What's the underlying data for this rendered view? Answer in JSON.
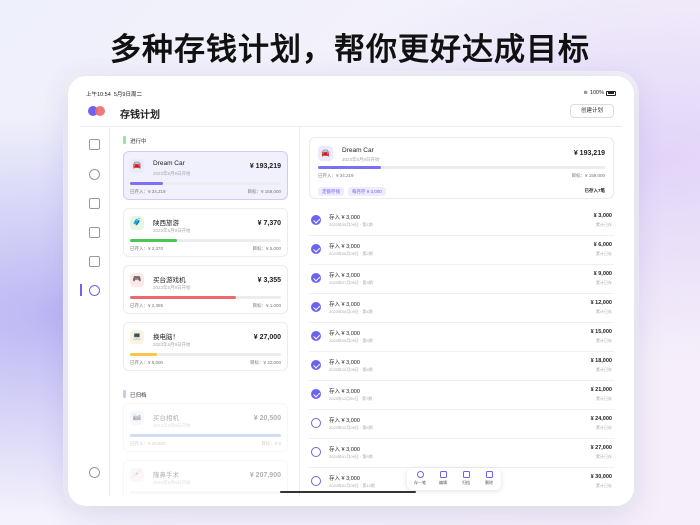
{
  "headline": "多种存钱计划，帮你更好达成目标",
  "status_bar": {
    "time": "上午10:54",
    "date": "5月9日周二",
    "battery": "100%"
  },
  "header": {
    "title": "存钱计划",
    "create_button": "创建计划"
  },
  "colors": {
    "accent": "#6c63f0",
    "green": "#4cc552",
    "red": "#ee6a6a",
    "yellow": "#f7c548"
  },
  "sections": {
    "active": "进行中",
    "archived": "已归档"
  },
  "plans": [
    {
      "icon": "car-icon",
      "glyph": "🚘",
      "name": "Dream Car",
      "date": "2023年5月9日开始",
      "amount": "¥ 193,219",
      "saved": "已存入：¥ 34,219",
      "goal": "目标：¥ 159,000",
      "progress": 0.22,
      "color": "#7b6ff2",
      "icon_bg": "#ebeafc"
    },
    {
      "icon": "luggage-icon",
      "glyph": "🧳",
      "name": "陕西旅游",
      "date": "2023年5月9日开始",
      "amount": "¥ 7,370",
      "saved": "已存入：¥ 2,370",
      "goal": "目标：¥ 5,000",
      "progress": 0.31,
      "color": "#4cc552",
      "icon_bg": "#e6f6e6"
    },
    {
      "icon": "gamepad-icon",
      "glyph": "🎮",
      "name": "买台游戏机",
      "date": "2023年5月9日开始",
      "amount": "¥ 3,355",
      "saved": "已存入：¥ 2,355",
      "goal": "目标：¥ 1,000",
      "progress": 0.7,
      "color": "#ee6a6a",
      "icon_bg": "#fde8e8"
    },
    {
      "icon": "computer-icon",
      "glyph": "💻",
      "name": "换电脑！",
      "date": "2023年5月9日开始",
      "amount": "¥ 27,000",
      "saved": "已存入：¥ 5,000",
      "goal": "目标：¥ 22,000",
      "progress": 0.18,
      "color": "#f7c548",
      "icon_bg": "#fdf3dc"
    }
  ],
  "archived_plans": [
    {
      "icon": "camera-icon",
      "glyph": "📷",
      "name": "买台相机",
      "date": "2023年5月9日开始",
      "amount": "¥ 20,500",
      "saved": "已存入：¥ 20,500",
      "goal": "目标：¥ 0",
      "progress": 1.0,
      "color": "#7b9cf2",
      "icon_bg": "#e6ecfc"
    },
    {
      "icon": "surgery-icon",
      "glyph": "💉",
      "name": "隆鼻手术",
      "date": "2023年5月9日开始",
      "amount": "¥ 207,900",
      "saved": "",
      "goal": "",
      "progress": 0,
      "color": "#ee6a6a",
      "icon_bg": "#fde8e8"
    }
  ],
  "detail": {
    "name": "Dream Car",
    "date": "2023年5月9日开始",
    "amount": "¥ 193,219",
    "saved": "已存入：¥ 34,219",
    "goal": "目标：¥ 159,000",
    "progress": 0.22,
    "tags": [
      "定额存钱",
      "每月存 ¥ 3,000"
    ],
    "count": "已存入7笔"
  },
  "deposits": [
    {
      "title": "存入 ¥ 3,000",
      "date": "2023年05月09日 · 第1期",
      "amount": "¥ 3,000",
      "label": "累计已存",
      "done": true
    },
    {
      "title": "存入 ¥ 3,000",
      "date": "2023年06月09日 · 第2期",
      "amount": "¥ 6,000",
      "label": "累计已存",
      "done": true
    },
    {
      "title": "存入 ¥ 3,000",
      "date": "2023年07月09日 · 第3期",
      "amount": "¥ 9,000",
      "label": "累计已存",
      "done": true
    },
    {
      "title": "存入 ¥ 3,000",
      "date": "2023年08月09日 · 第4期",
      "amount": "¥ 12,000",
      "label": "累计已存",
      "done": true
    },
    {
      "title": "存入 ¥ 3,000",
      "date": "2023年09月09日 · 第5期",
      "amount": "¥ 15,000",
      "label": "累计已存",
      "done": true
    },
    {
      "title": "存入 ¥ 3,000",
      "date": "2023年10月09日 · 第6期",
      "amount": "¥ 18,000",
      "label": "累计已存",
      "done": true
    },
    {
      "title": "存入 ¥ 3,000",
      "date": "2023年11月09日 · 第7期",
      "amount": "¥ 21,000",
      "label": "累计已存",
      "done": true
    },
    {
      "title": "存入 ¥ 3,000",
      "date": "2023年12月09日 · 第8期",
      "amount": "¥ 24,000",
      "label": "累计已存",
      "done": false
    },
    {
      "title": "存入 ¥ 3,000",
      "date": "2024年01月09日 · 第9期",
      "amount": "¥ 27,000",
      "label": "累计已存",
      "done": false
    },
    {
      "title": "存入 ¥ 3,000",
      "date": "2024年02月09日 · 第10期",
      "amount": "¥ 30,000",
      "label": "累计已存",
      "done": false
    }
  ],
  "dock": [
    {
      "label": "存一笔",
      "icon": "plus-circle-icon"
    },
    {
      "label": "编辑",
      "icon": "edit-icon"
    },
    {
      "label": "归档",
      "icon": "archive-icon"
    },
    {
      "label": "删除",
      "icon": "trash-icon"
    }
  ]
}
